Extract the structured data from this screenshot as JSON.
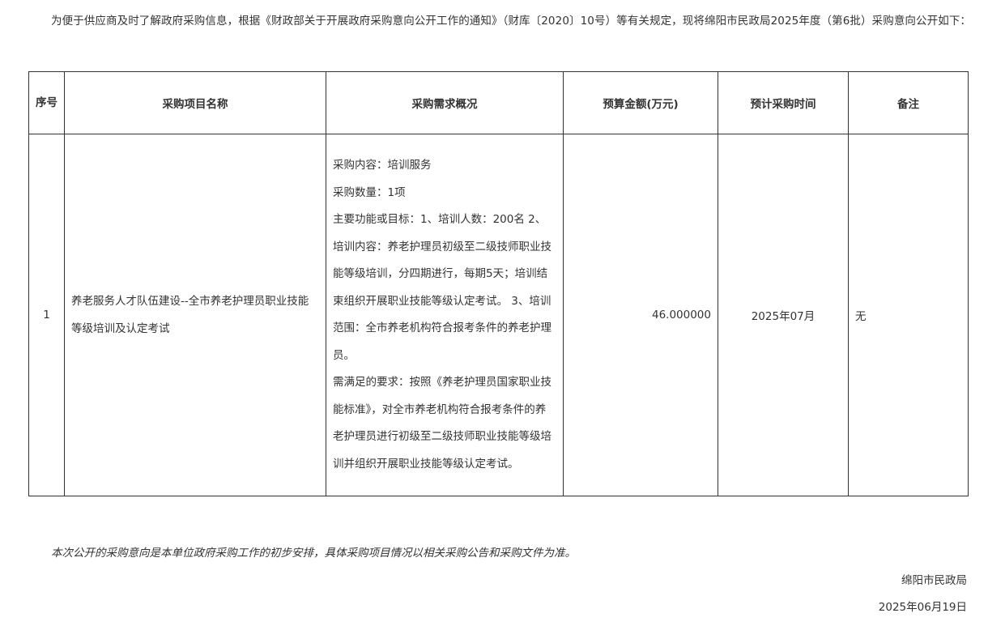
{
  "intro": "为便于供应商及时了解政府采购信息，根据《财政部关于开展政府采购意向公开工作的通知》（财库〔2020〕10号）等有关规定，现将绵阳市民政局2025年度（第6批）采购意向公开如下：",
  "table": {
    "headers": {
      "seq": "序号",
      "name": "采购项目名称",
      "overview": "采购需求概况",
      "budget": "预算金额(万元)",
      "time": "预计采购时间",
      "remark": "备注"
    },
    "rows": [
      {
        "seq": "1",
        "name": "养老服务人才队伍建设--全市养老护理员职业技能等级培训及认定考试",
        "overview": {
          "content": "采购内容：培训服务",
          "quantity": "采购数量：1项",
          "goal": "主要功能或目标：1、培训人数：200名 2、培训内容：养老护理员初级至二级技师职业技能等级培训，分四期进行，每期5天；培训结束组织开展职业技能等级认定考试。 3、培训范围：全市养老机构符合报考条件的养老护理员。",
          "requirement": "需满足的要求：按照《养老护理员国家职业技能标准》，对全市养老机构符合报考条件的养老护理员进行初级至二级技师职业技能等级培训并组织开展职业技能等级认定考试。"
        },
        "budget": "46.000000",
        "time": "2025年07月",
        "remark": "无"
      }
    ]
  },
  "note": "本次公开的采购意向是本单位政府采购工作的初步安排，具体采购项目情况以相关采购公告和采购文件为准。",
  "signature": {
    "agency": "绵阳市民政局",
    "date": "2025年06月19日"
  }
}
